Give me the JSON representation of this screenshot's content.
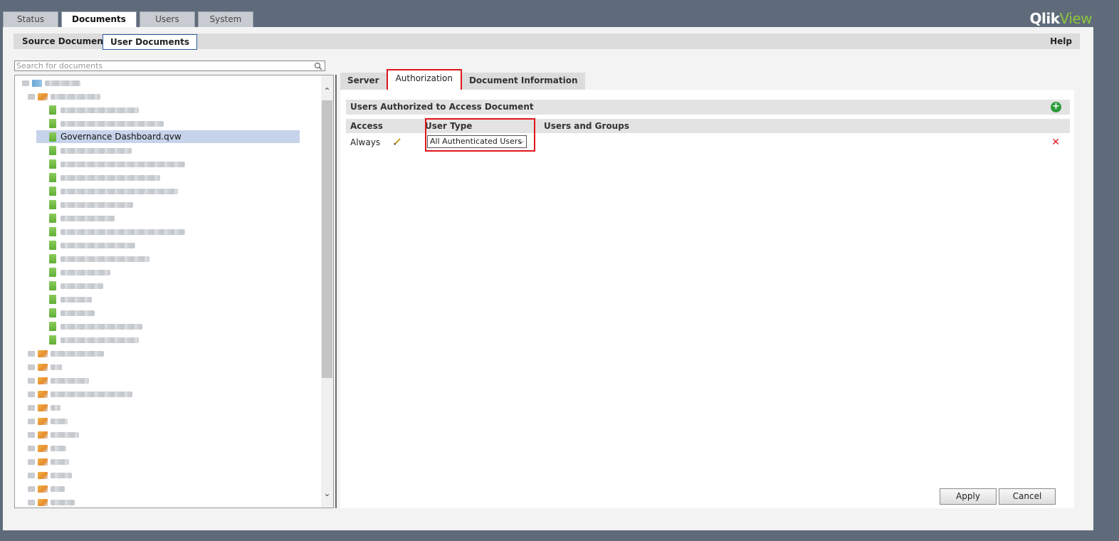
{
  "logo": {
    "q": "Qlik",
    "v": "View"
  },
  "top_tabs": [
    {
      "label": "Status"
    },
    {
      "label": "Documents"
    },
    {
      "label": "Users"
    },
    {
      "label": "System"
    }
  ],
  "subnav": {
    "source_documents": "Source Documents",
    "user_documents": "User Documents",
    "help": "Help"
  },
  "search": {
    "placeholder": "Search for documents"
  },
  "tree": {
    "selected_item": "Governance Dashboard.qvw"
  },
  "right_tabs": [
    {
      "label": "Server"
    },
    {
      "label": "Authorization"
    },
    {
      "label": "Document Information"
    }
  ],
  "authorization": {
    "section_title": "Users Authorized to Access Document",
    "columns": {
      "access": "Access",
      "user_type": "User Type",
      "users_groups": "Users and Groups"
    },
    "row": {
      "access": "Always",
      "user_type": "All Authenticated Users"
    }
  },
  "buttons": {
    "apply": "Apply",
    "cancel": "Cancel"
  },
  "colors": {
    "highlight": "#e0161c",
    "selection": "#c7d3ea",
    "add": "#2d9b3a",
    "brand_green": "#8cc63f"
  }
}
